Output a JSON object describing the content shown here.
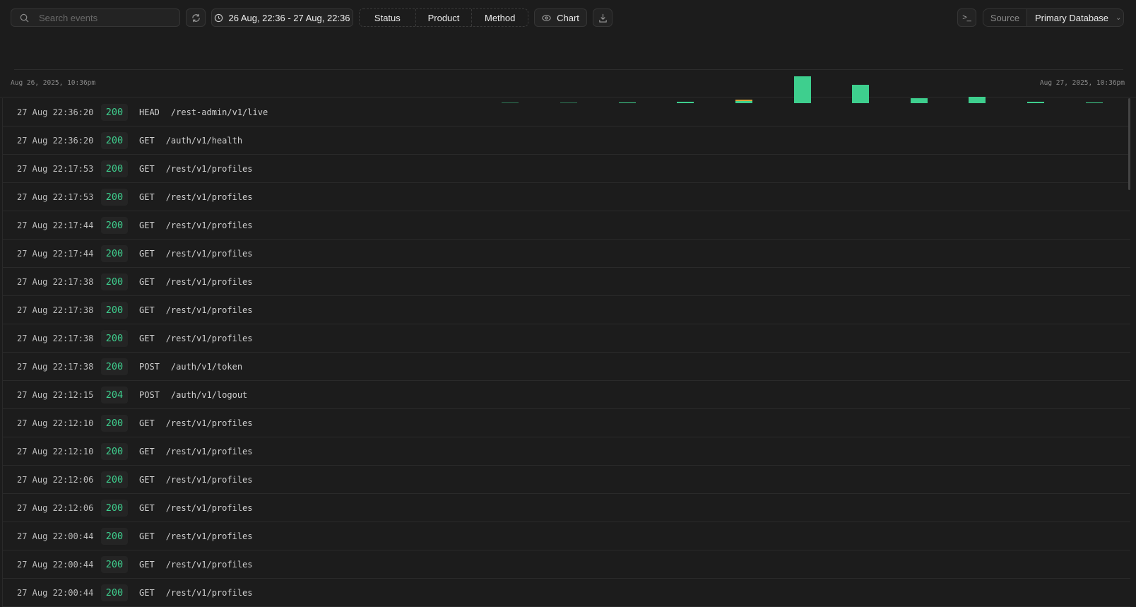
{
  "toolbar": {
    "search_placeholder": "Search events",
    "date_range": "26 Aug, 22:36 - 27 Aug, 22:36",
    "filters": [
      "Status",
      "Product",
      "Method"
    ],
    "chart_label": "Chart",
    "source_label": "Source",
    "source_value": "Primary Database"
  },
  "chart_data": {
    "type": "bar",
    "x_start_label": "Aug 26, 2025, 10:36pm",
    "x_end_label": "Aug 27, 2025, 10:36pm",
    "series": [
      {
        "name": "success",
        "color": "#3ecf8e",
        "values": [
          0,
          0,
          0,
          0,
          0,
          0,
          0,
          0,
          0.3,
          0.2,
          1,
          2,
          3,
          38,
          26,
          7,
          9,
          2,
          1
        ]
      },
      {
        "name": "warning",
        "color": "#d8a23a",
        "values": [
          0,
          0,
          0,
          0,
          0,
          0,
          0,
          0,
          0,
          0,
          0,
          0,
          2,
          0,
          0,
          0,
          0,
          0,
          0
        ]
      }
    ]
  },
  "rows": [
    {
      "time": "27 Aug 22:36:20",
      "status": "200",
      "method": "HEAD",
      "path": "/rest-admin/v1/live"
    },
    {
      "time": "27 Aug 22:36:20",
      "status": "200",
      "method": "GET",
      "path": "/auth/v1/health"
    },
    {
      "time": "27 Aug 22:17:53",
      "status": "200",
      "method": "GET",
      "path": "/rest/v1/profiles"
    },
    {
      "time": "27 Aug 22:17:53",
      "status": "200",
      "method": "GET",
      "path": "/rest/v1/profiles"
    },
    {
      "time": "27 Aug 22:17:44",
      "status": "200",
      "method": "GET",
      "path": "/rest/v1/profiles"
    },
    {
      "time": "27 Aug 22:17:44",
      "status": "200",
      "method": "GET",
      "path": "/rest/v1/profiles"
    },
    {
      "time": "27 Aug 22:17:38",
      "status": "200",
      "method": "GET",
      "path": "/rest/v1/profiles"
    },
    {
      "time": "27 Aug 22:17:38",
      "status": "200",
      "method": "GET",
      "path": "/rest/v1/profiles"
    },
    {
      "time": "27 Aug 22:17:38",
      "status": "200",
      "method": "GET",
      "path": "/rest/v1/profiles"
    },
    {
      "time": "27 Aug 22:17:38",
      "status": "200",
      "method": "POST",
      "path": "/auth/v1/token"
    },
    {
      "time": "27 Aug 22:12:15",
      "status": "204",
      "method": "POST",
      "path": "/auth/v1/logout"
    },
    {
      "time": "27 Aug 22:12:10",
      "status": "200",
      "method": "GET",
      "path": "/rest/v1/profiles"
    },
    {
      "time": "27 Aug 22:12:10",
      "status": "200",
      "method": "GET",
      "path": "/rest/v1/profiles"
    },
    {
      "time": "27 Aug 22:12:06",
      "status": "200",
      "method": "GET",
      "path": "/rest/v1/profiles"
    },
    {
      "time": "27 Aug 22:12:06",
      "status": "200",
      "method": "GET",
      "path": "/rest/v1/profiles"
    },
    {
      "time": "27 Aug 22:00:44",
      "status": "200",
      "method": "GET",
      "path": "/rest/v1/profiles"
    },
    {
      "time": "27 Aug 22:00:44",
      "status": "200",
      "method": "GET",
      "path": "/rest/v1/profiles"
    },
    {
      "time": "27 Aug 22:00:44",
      "status": "200",
      "method": "GET",
      "path": "/rest/v1/profiles"
    }
  ]
}
